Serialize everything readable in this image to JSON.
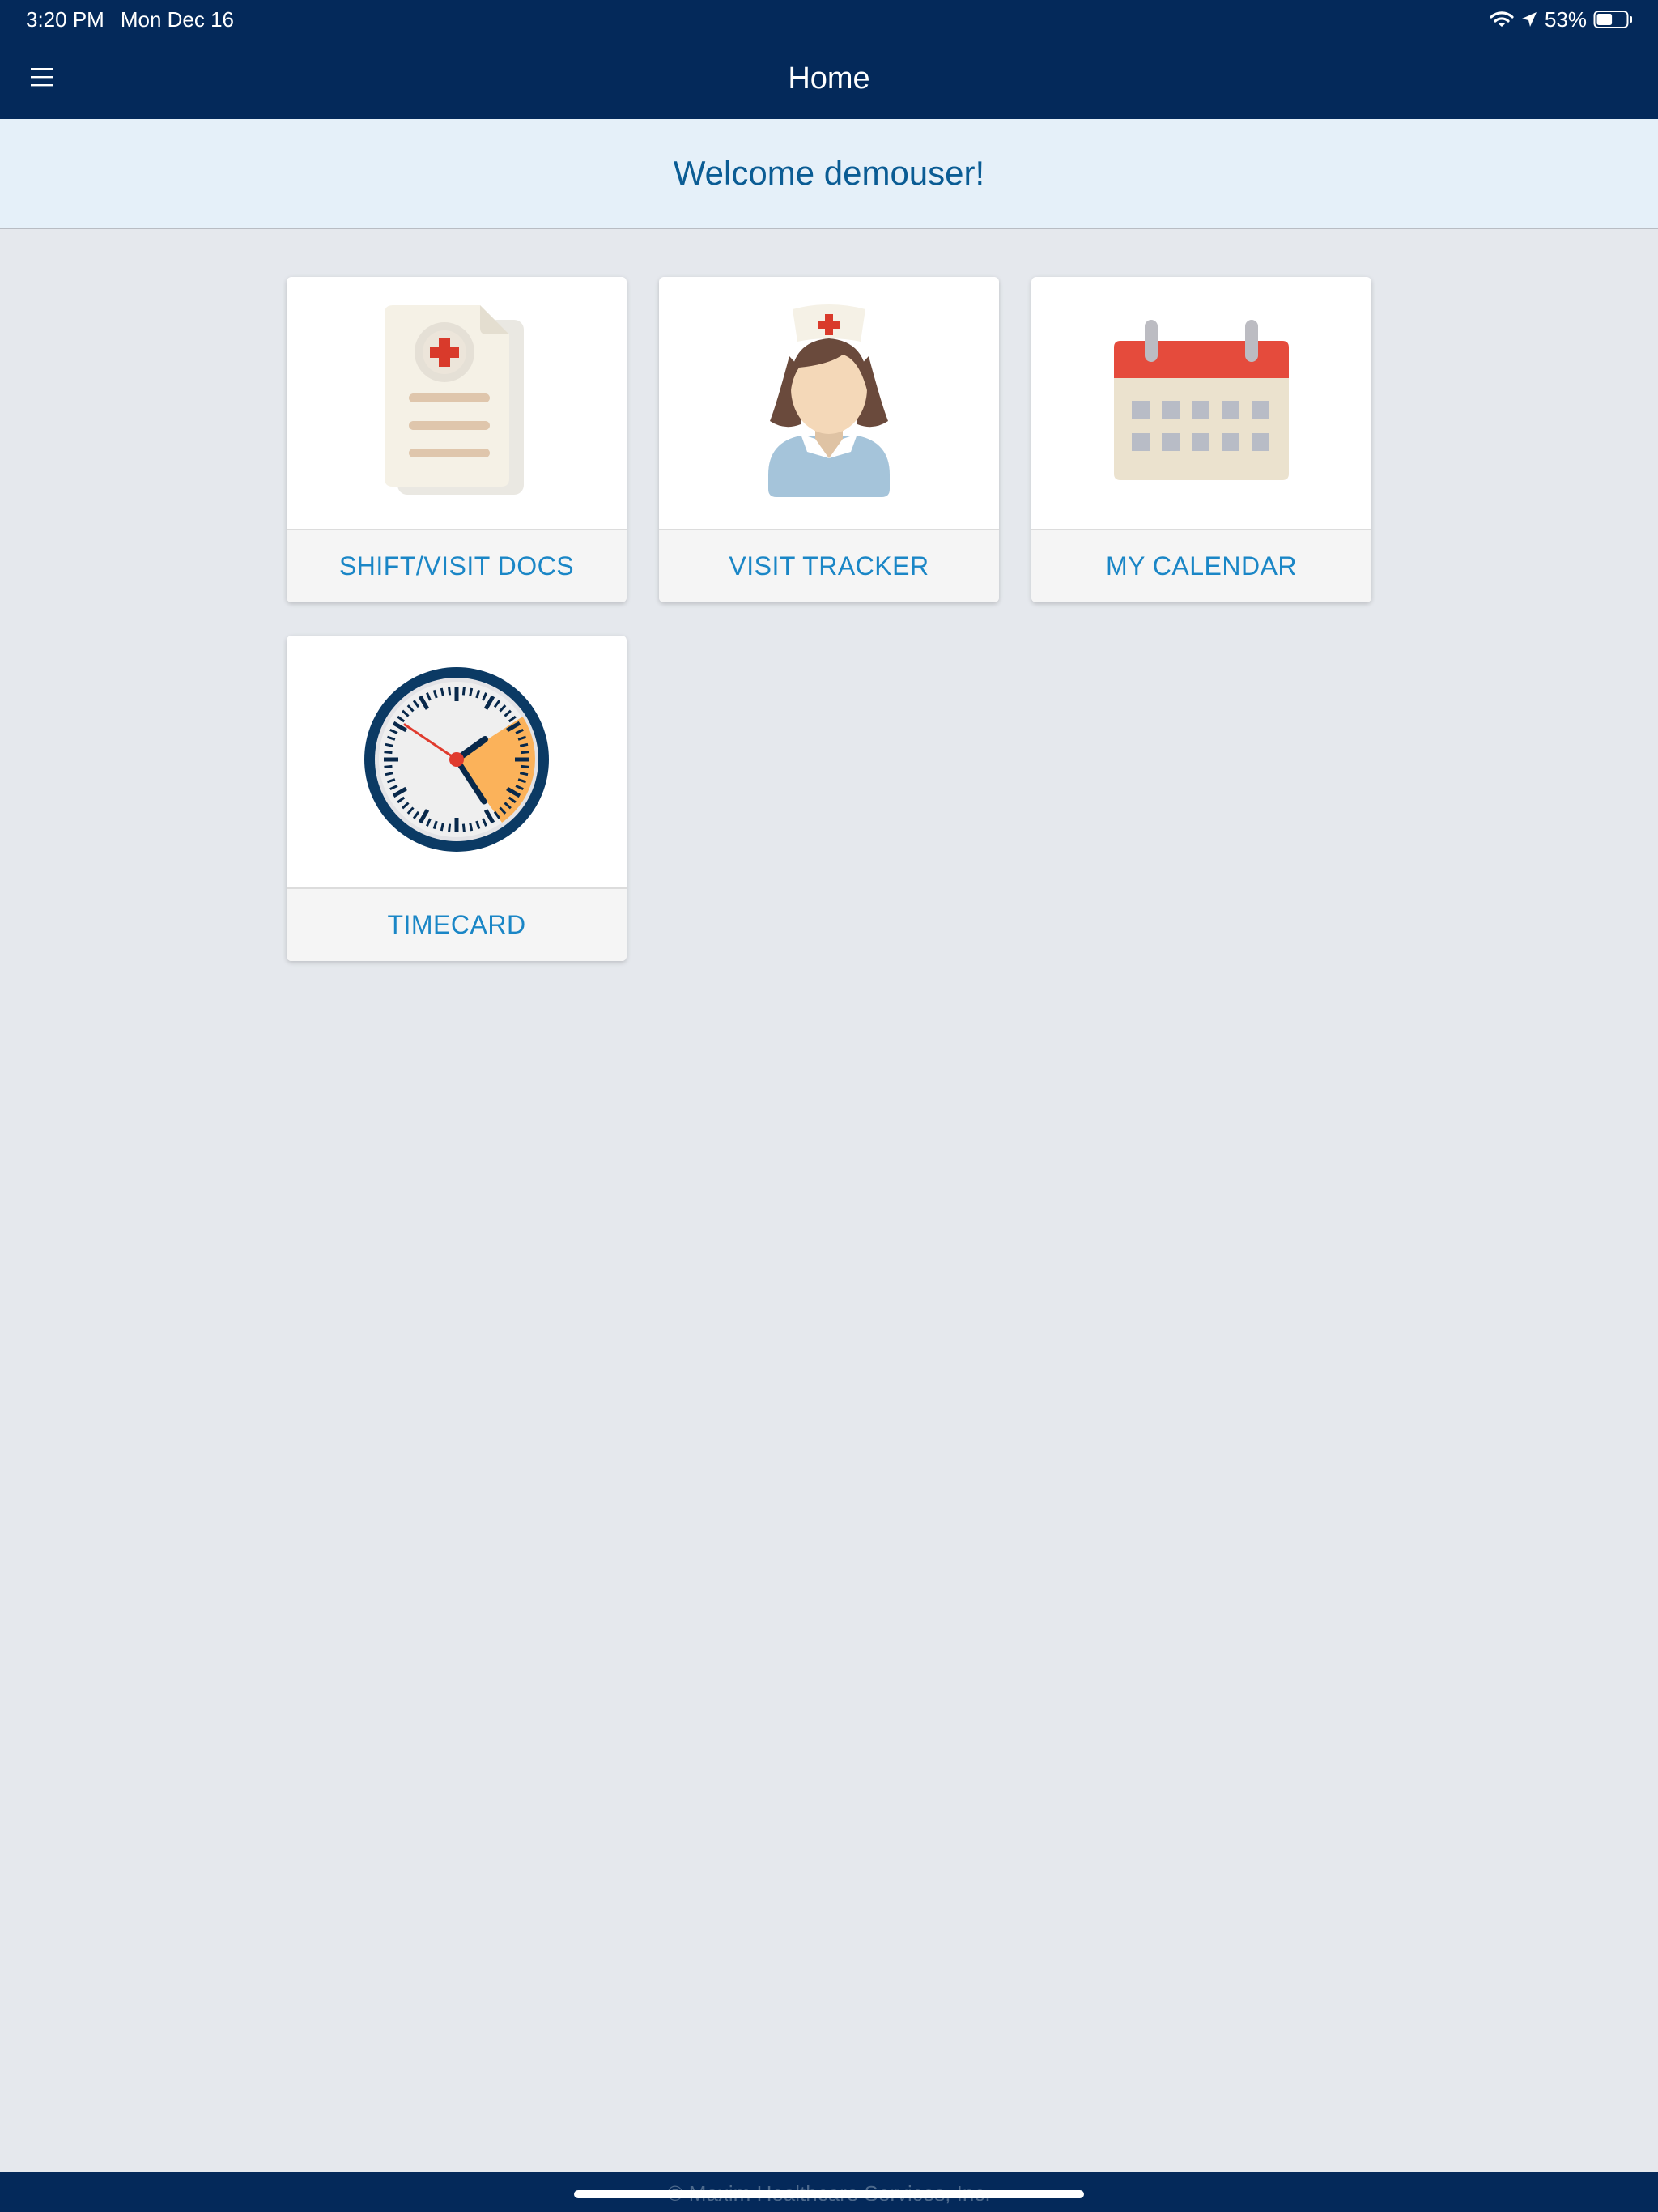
{
  "status_bar": {
    "time": "3:20 PM",
    "date": "Mon Dec 16",
    "battery": "53%",
    "battery_level": 0.53,
    "icons": [
      "wifi-icon",
      "location-arrow-icon",
      "battery-icon"
    ]
  },
  "nav_bar": {
    "title": "Home",
    "menu_icon": "hamburger-menu-icon"
  },
  "welcome": {
    "message": "Welcome demouser!"
  },
  "tiles": [
    {
      "label": "SHIFT/VISIT DOCS",
      "icon": "medical-document-icon"
    },
    {
      "label": "VISIT TRACKER",
      "icon": "nurse-icon"
    },
    {
      "label": "MY CALENDAR",
      "icon": "calendar-icon"
    },
    {
      "label": "TIMECARD",
      "icon": "clock-icon"
    }
  ],
  "footer": {
    "text": "© Maxim Healthcare Services, Inc."
  },
  "colors": {
    "header_bg": "#04295a",
    "welcome_bg": "#e5f0f9",
    "welcome_text": "#0a5c94",
    "page_bg": "#e5e8ed",
    "tile_label": "#1a86c6"
  }
}
